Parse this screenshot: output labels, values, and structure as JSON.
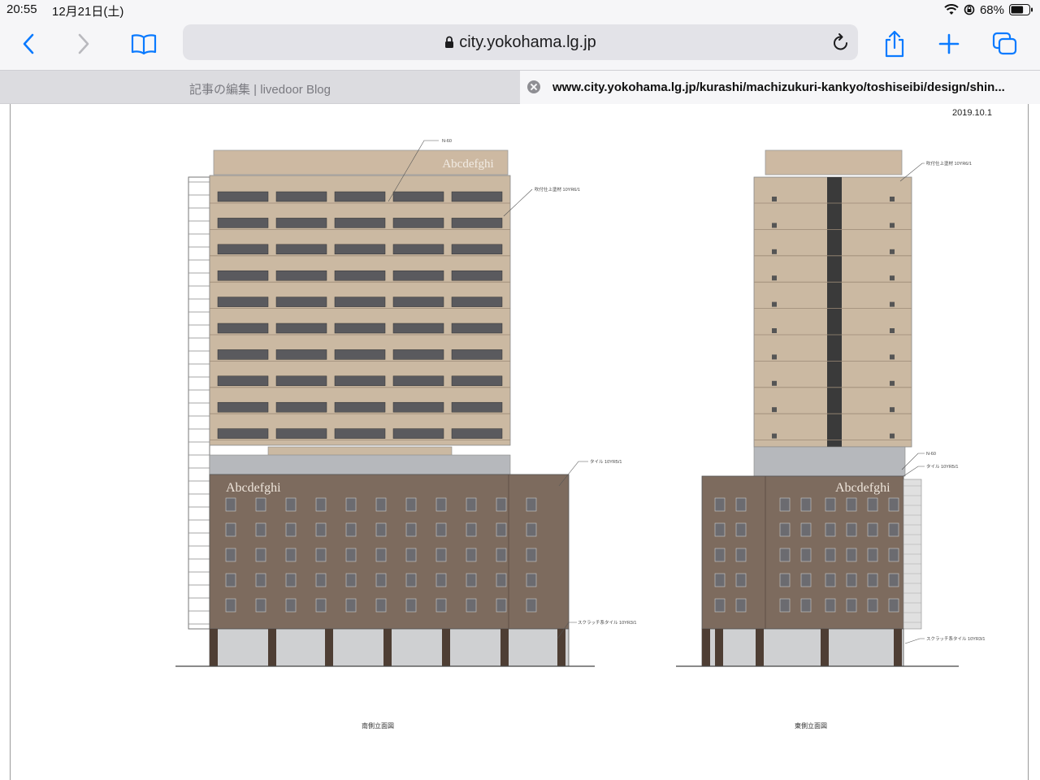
{
  "status_bar": {
    "time": "20:55",
    "date": "12月21日(土)",
    "battery": "68%",
    "battery_level": 0.68
  },
  "toolbar": {
    "back_icon": "chevron-left-icon",
    "forward_icon": "chevron-right-icon",
    "bookmarks_icon": "book-icon",
    "url": "city.yokohama.lg.jp",
    "share_icon": "share-icon",
    "new_tab_icon": "plus-icon",
    "tabs_icon": "tabs-icon"
  },
  "tabs": [
    {
      "title": "記事の編集 | livedoor Blog",
      "active": false
    },
    {
      "title": "www.city.yokohama.lg.jp/kurashi/machizukuri-kankyo/toshiseibi/design/shin...",
      "active": true
    }
  ],
  "document": {
    "date": "2019.10.1",
    "south": {
      "caption": "南側立面図",
      "sign_top": "Abcdefghi",
      "sign_podium": "Abcdefghi",
      "notes": [
        "N-60",
        "吹付仕上塗材 10YR6/1",
        "タイル 10YR5/1",
        "スクラッチ系タイル 10YR3/1"
      ]
    },
    "east": {
      "caption": "東側立面図",
      "sign_podium": "Abcdefghi",
      "notes": [
        "吹付仕上塗材 10YR6/1",
        "N-60",
        "タイル 10YR5/1",
        "スクラッチ系タイル 10YR3/1"
      ]
    }
  },
  "colors": {
    "tower": "#cbb9a2",
    "podium": "#7d6b5e",
    "base": "#4e3e34",
    "accent_blue": "#0a7aff"
  }
}
